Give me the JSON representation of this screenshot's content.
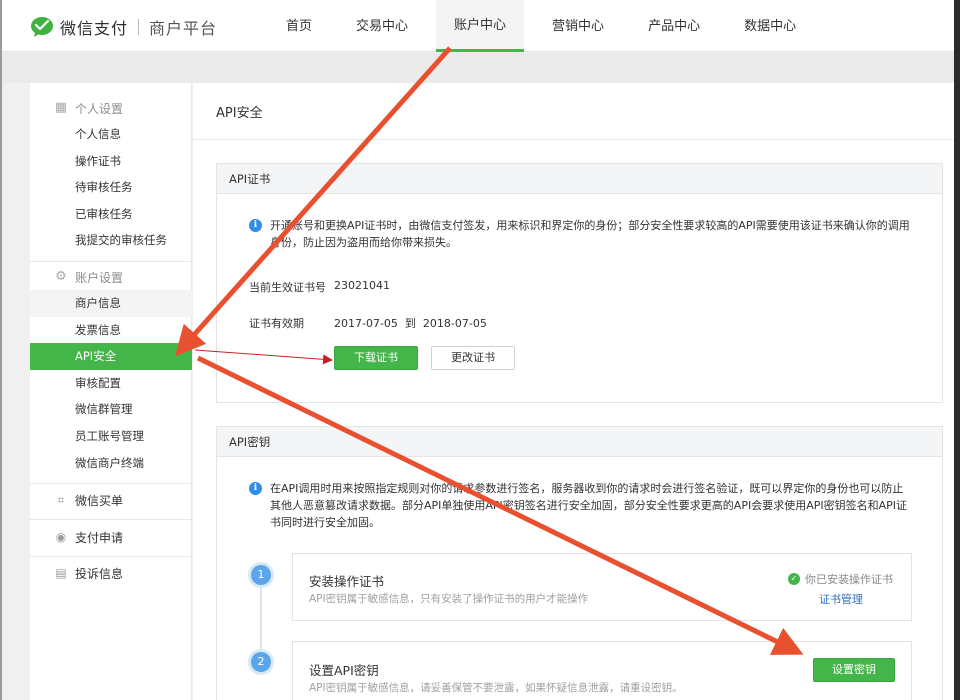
{
  "brand": {
    "name": "微信支付",
    "sub": "商户平台"
  },
  "nav": [
    "首页",
    "交易中心",
    "账户中心",
    "营销中心",
    "产品中心",
    "数据中心"
  ],
  "nav_active": 2,
  "sidebar": {
    "group1": {
      "title": "个人设置",
      "items": [
        "个人信息",
        "操作证书",
        "待审核任务",
        "已审核任务",
        "我提交的审核任务"
      ]
    },
    "group2": {
      "title": "账户设置",
      "items": [
        "商户信息",
        "发票信息",
        "API安全",
        "审核配置",
        "微信群管理",
        "员工账号管理",
        "微信商户终端"
      ]
    },
    "singles": [
      "微信买单",
      "支付申请",
      "投诉信息"
    ]
  },
  "page": {
    "title": "API安全"
  },
  "cert": {
    "header": "API证书",
    "info": "开通账号和更换API证书时，由微信支付签发，用来标识和界定你的身份；部分安全性要求较高的API需要使用该证书来确认你的调用身份，防止因为盗用而给你带来损失。",
    "serial_label": "当前生效证书号",
    "serial_value": "23021041",
    "valid_label": "证书有效期",
    "valid_value": "2017-07-05  到  2018-07-05",
    "download_btn": "下载证书",
    "change_btn": "更改证书"
  },
  "key": {
    "header": "API密钥",
    "info": "在API调用时用来按照指定规则对你的请求参数进行签名，服务器收到你的请求时会进行签名验证，既可以界定你的身份也可以防止其他人恶意篡改请求数据。部分API单独使用API密钥签名进行安全加固，部分安全性要求更高的API会要求使用API密钥签名和API证书同时进行安全加固。",
    "steps": [
      {
        "num": "1",
        "title": "安装操作证书",
        "desc": "API密钥属于敏感信息，只有安装了操作证书的用户才能操作",
        "status": "你已安装操作证书",
        "link": "证书管理"
      },
      {
        "num": "2",
        "title": "设置API密钥",
        "desc": "API密钥属于敏感信息，请妥善保管不要泄露，如果怀疑信息泄露，请重设密钥。",
        "button": "设置密钥"
      }
    ]
  },
  "colors": {
    "accent": "#44b549",
    "info": "#2e8ded",
    "annotation_arrow": "#e8502f"
  }
}
